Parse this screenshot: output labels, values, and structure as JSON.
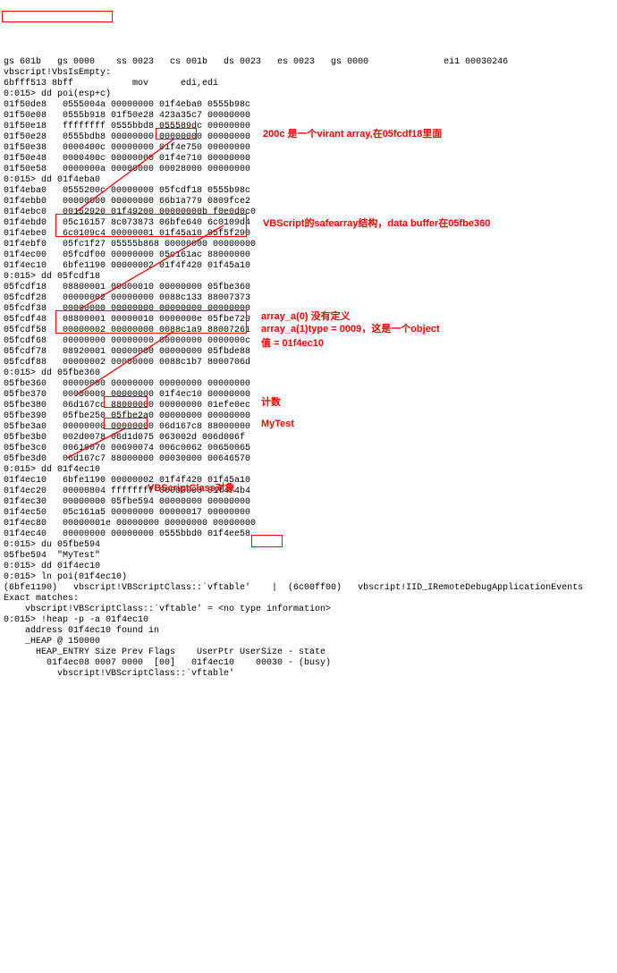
{
  "lines": [
    "gs 601b   gs 0000    ss 0023   cs 001b   ds 0023   es 0023   gs 0000              ei1 00030246",
    "vbscript!VbsIsEmpty:",
    "6bfff513 8bff           mov      edi,edi",
    "0:015> dd poi(esp+c)",
    "01f50de8   0555004a 00000000 01f4eba0 0555b98c",
    "01f50e08   0555b918 01f50e28 423a35c7 00000000",
    "01f50e18   ffffffff 0555bbd8 055589dc 00000000",
    "01f50e28   0555bdb8 00000000 00000000 00000000",
    "01f50e38   0000400c 00000000 01f4e750 00000000",
    "01f50e48   0000400c 00000000 01f4e710 00000000",
    "01f50e58   0000000a 00000000 00028000 00000000",
    "0:015> dd 01f4eba0",
    "01f4eba0   0555200c 00000000 05fcdf18 0555b98c",
    "01f4ebb0   00000000 00000000 66b1a779 0809fce2",
    "01f4ebc0   00152920 01f49200 00000000b f0e0d0c0",
    "01f4ebd0   05c16157 8c073873 06bfe640 6c0109d4",
    "01f4ebe0   6c0109c4 00000001 01f45a10 05f5f290",
    "01f4ebf0   05fc1f27 05555b868 00000000 00000000",
    "01f4ec00   05fcdf00 00000000 05c161ac 88000000",
    "01f4ec10   6bfe1190 00000002 01f4f420 01f45a10",
    "0:015> dd 05fcdf18",
    "05fcdf18   08800001 00000010 00000000 05fbe360",
    "05fcdf28   00000002 00000000 0088c133 88007373",
    "05fcdf38   00000000 00000000 00000000 00000000",
    "05fcdf48   08800001 00000010 0000000e 05fbe720",
    "05fcdf58   00000002 00000000 0088c1a9 88007261",
    "05fcdf68   00000000 00000000 00000000 0000000c",
    "05fcdf78   08920001 00000000 00000000 05fbde88",
    "05fcdf88   00000002 00000000 0088c1b7 8000706d",
    "0:015> dd 05fbe360",
    "05fbe360   00000000 00000000 00000000 00000000",
    "05fbe370   00000009 00000000 01f4ec10 00000000",
    "05fbe380   06d167cd 88000000 00000000 01efe0ec",
    "05fbe390   05fbe250 05fbe2a0 00000000 00000000",
    "05fbe3a0   00000000 00000000 06d167c8 88000000",
    "05fbe3b0   002d0078 06d1d075 063002d 006d006f",
    "05fbe3c0   00610070 00690074 006c0062 00650065",
    "05fbe3d0   06d167c7 88000000 00030000 00646570",
    "0:015> dd 01f4ec10",
    "01f4ec10   6bfe1190 00000002 01f4f420 01f45a10",
    "01f4ec20   00000804 ffffffff 00000000 01f4f4b4",
    "01f4ec30   00000000 05fbe594 00000000 00000000",
    "01f4ec50   05c161a5 00000000 00000017 00000000",
    "01f4ec80   00000001e 00000000 00000000 00000000",
    "01f4ec40   00000000 00000000 0555bbd0 01f4ee58",
    "0:015> du 05fbe594",
    "05fbe594  \"MyTest\"",
    "0:015> dd 01f4ec10",
    "0:015> ln poi(01f4ec10)",
    "(6bfe1190)   vbscript!VBScriptClass::`vftable'    |  (6c00ff00)   vbscript!IID_IRemoteDebugApplicationEvents",
    "Exact matches:",
    "    vbscript!VBScriptClass::`vftable' = <no type information>",
    "0:015> !heap -p -a 01f4ec10",
    "    address 01f4ec10 found in",
    "    _HEAP @ 150000",
    "      HEAP_ENTRY Size Prev Flags    UserPtr UserSize - state",
    "        01f4ec08 0007 0000  [00]   01f4ec10    00030 - (busy)",
    "          vbscript!VBScriptClass::`vftable'"
  ],
  "annotations": {
    "a1": "200c 是一个virant array,在05fcdf18里面",
    "a2": "VBScript的safearray结构，data buffer在05fbe360",
    "a3a": "array_a(0) 没有定义",
    "a3b": "array_a(1)type = 0009，这是一个object",
    "a3c": "值 = 01f4ec10",
    "a4": "计数",
    "a5": "MyTest",
    "a6": "VBScriptClass对象"
  }
}
